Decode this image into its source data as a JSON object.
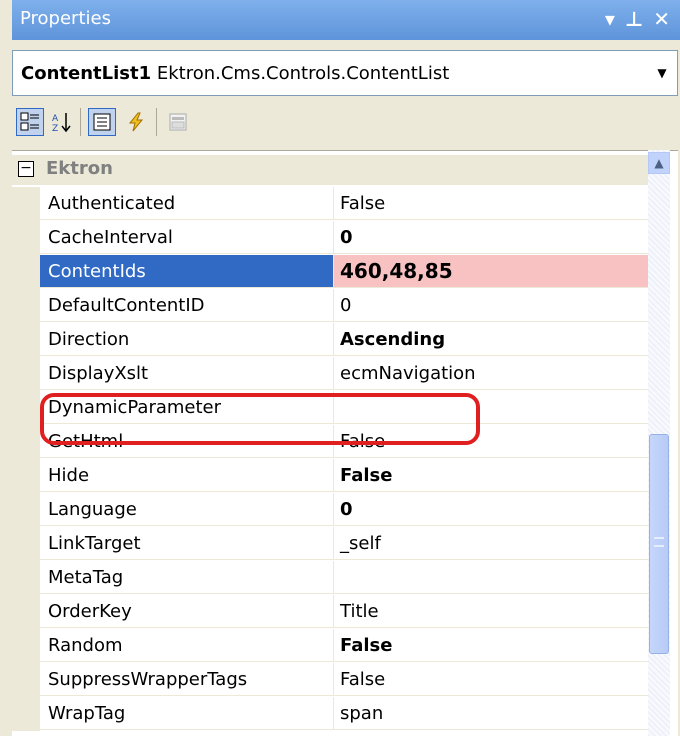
{
  "window": {
    "title": "Properties",
    "buttons": {
      "dropdown": "▾",
      "pin": "⊥",
      "close": "✕"
    }
  },
  "object_selector": {
    "object_name": "ContentList1",
    "object_type": "Ektron.Cms.Controls.ContentList"
  },
  "toolbar": {
    "buttons": [
      {
        "name": "categorized",
        "icon": "categorized-icon"
      },
      {
        "name": "alphabetical",
        "icon": "sort-az-icon"
      },
      {
        "name": "properties",
        "icon": "properties-icon"
      },
      {
        "name": "events",
        "icon": "lightning-icon"
      },
      {
        "name": "property-pages",
        "icon": "property-pages-icon"
      }
    ]
  },
  "category": {
    "label": "Ektron",
    "toggle": "−"
  },
  "properties": [
    {
      "name": "Authenticated",
      "value": "False",
      "bold": false
    },
    {
      "name": "CacheInterval",
      "value": "0",
      "bold": true
    },
    {
      "name": "ContentIds",
      "value": "460,48,85",
      "bold": true,
      "selected": true
    },
    {
      "name": "DefaultContentID",
      "value": "0",
      "bold": false
    },
    {
      "name": "Direction",
      "value": "Ascending",
      "bold": true
    },
    {
      "name": "DisplayXslt",
      "value": "ecmNavigation",
      "bold": false
    },
    {
      "name": "DynamicParameter",
      "value": "",
      "bold": false
    },
    {
      "name": "GetHtml",
      "value": "False",
      "bold": false
    },
    {
      "name": "Hide",
      "value": "False",
      "bold": true
    },
    {
      "name": "Language",
      "value": "0",
      "bold": true
    },
    {
      "name": "LinkTarget",
      "value": "_self",
      "bold": false
    },
    {
      "name": "MetaTag",
      "value": "",
      "bold": false
    },
    {
      "name": "OrderKey",
      "value": "Title",
      "bold": false
    },
    {
      "name": "Random",
      "value": "False",
      "bold": true
    },
    {
      "name": "SuppressWrapperTags",
      "value": "False",
      "bold": false
    },
    {
      "name": "WrapTag",
      "value": "span",
      "bold": false
    }
  ],
  "colors": {
    "selection": "#316ac5",
    "highlight_ring": "#e02020",
    "selected_value_bg": "#f8c2c2"
  }
}
